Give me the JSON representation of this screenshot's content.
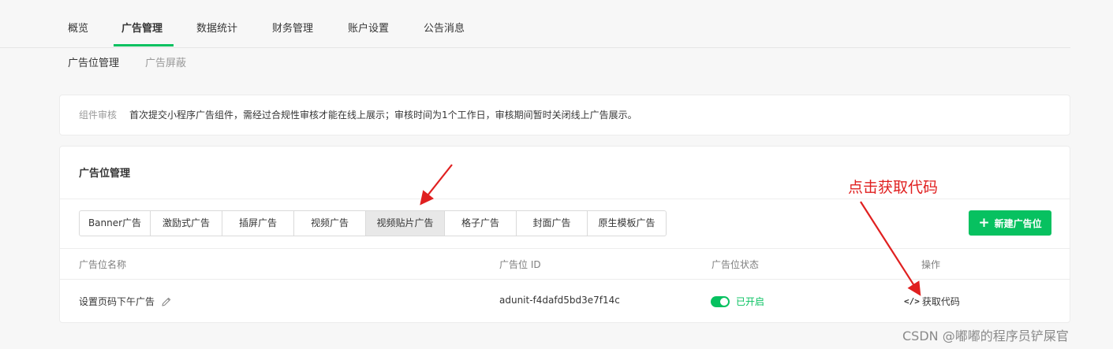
{
  "top_tabs": [
    {
      "label": "概览",
      "active": false
    },
    {
      "label": "广告管理",
      "active": true
    },
    {
      "label": "数据统计",
      "active": false
    },
    {
      "label": "财务管理",
      "active": false
    },
    {
      "label": "账户设置",
      "active": false
    },
    {
      "label": "公告消息",
      "active": false
    }
  ],
  "sub_tabs": [
    {
      "label": "广告位管理",
      "active": true
    },
    {
      "label": "广告屏蔽",
      "active": false
    }
  ],
  "notice": {
    "label": "组件审核",
    "text": "首次提交小程序广告组件，需经过合规性审核才能在线上展示；审核时间为1个工作日，审核期间暂时关闭线上广告展示。"
  },
  "panel": {
    "title": "广告位管理",
    "ad_types": [
      {
        "label": "Banner广告",
        "selected": false
      },
      {
        "label": "激励式广告",
        "selected": false
      },
      {
        "label": "插屏广告",
        "selected": false
      },
      {
        "label": "视频广告",
        "selected": false
      },
      {
        "label": "视频贴片广告",
        "selected": true
      },
      {
        "label": "格子广告",
        "selected": false
      },
      {
        "label": "封面广告",
        "selected": false
      },
      {
        "label": "原生模板广告",
        "selected": false
      }
    ],
    "new_button": {
      "icon": "plus-icon",
      "label": "新建广告位"
    },
    "columns": [
      "广告位名称",
      "广告位 ID",
      "广告位状态",
      "操作"
    ],
    "rows": [
      {
        "name": "设置页码下午广告",
        "edit_icon": "pencil-icon",
        "id": "adunit-f4dafd5bd3e7f14c",
        "status": "已开启",
        "status_on": true,
        "action_icon": "code-icon",
        "action_glyph": "</>",
        "action": "获取代码"
      }
    ]
  },
  "annotation": {
    "text": "点击获取代码",
    "color": "#e02020"
  },
  "watermark": "CSDN @嘟嘟的程序员铲屎官",
  "colors": {
    "accent": "#07c160",
    "annotation": "#e02020"
  }
}
